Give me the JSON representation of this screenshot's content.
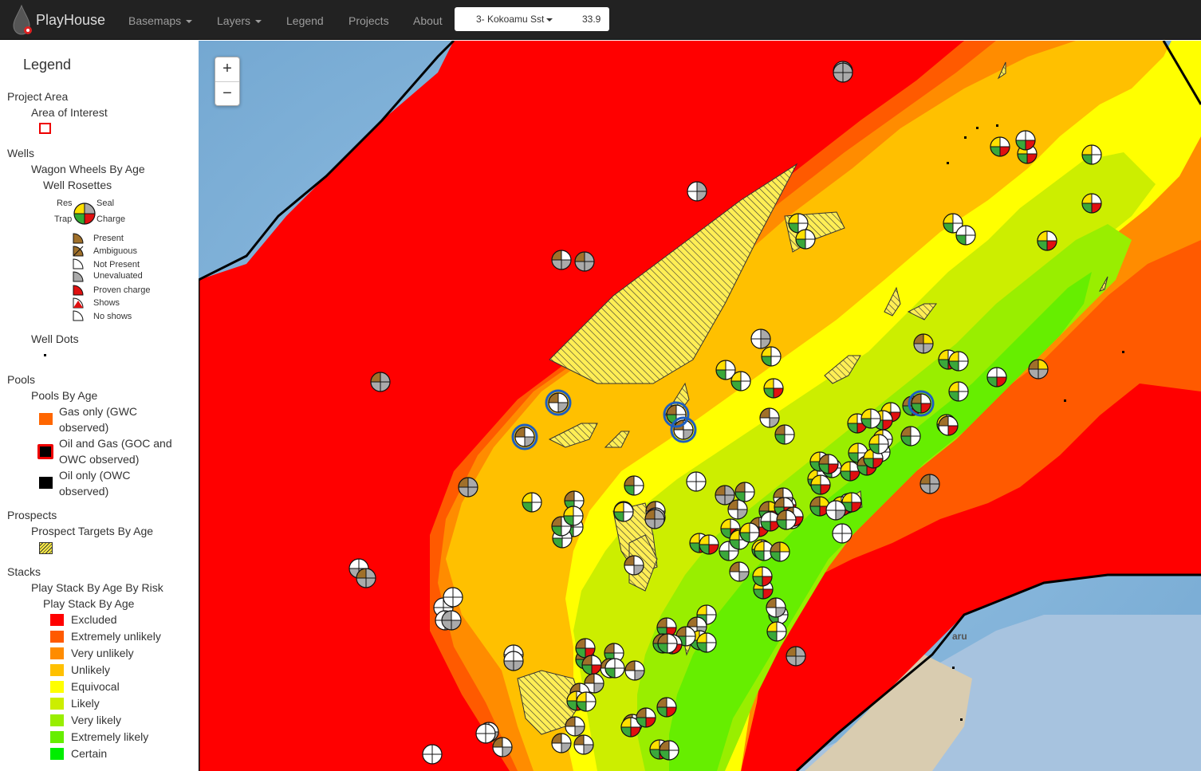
{
  "navbar": {
    "brand": "PlayHouse",
    "menu": {
      "basemaps": "Basemaps",
      "layers": "Layers",
      "legend": "Legend",
      "projects": "Projects",
      "about": "About"
    },
    "stack_select": {
      "selected": "3- Kokoamu Sst",
      "value": "33.9"
    }
  },
  "legend": {
    "title": "Legend",
    "project_area": {
      "heading": "Project Area",
      "item": "Area of Interest"
    },
    "wells": {
      "heading": "Wells",
      "wagon_wheels": "Wagon Wheels By Age",
      "well_rosettes": "Well Rosettes",
      "rosette_labels": {
        "res": "Res",
        "seal": "Seal",
        "trap": "Trap",
        "charge": "Charge"
      },
      "symbols": [
        "Present",
        "Ambiguous",
        "Not Present",
        "Unevaluated",
        "Proven charge",
        "Shows",
        "No shows"
      ],
      "well_dots": "Well Dots"
    },
    "pools": {
      "heading": "Pools",
      "by_age": "Pools By Age",
      "items": [
        {
          "line1": "Gas only (GWC",
          "line2": "observed)",
          "color": "#ff6600"
        },
        {
          "line1": "Oil and Gas (GOC and",
          "line2": "OWC observed)",
          "color": "#000000"
        },
        {
          "line1": "Oil only (OWC",
          "line2": "observed)",
          "color": "#000000"
        }
      ]
    },
    "prospects": {
      "heading": "Prospects",
      "targets": "Prospect Targets By Age"
    },
    "stacks": {
      "heading": "Stacks",
      "play_stack_risk": "Play Stack By Age By Risk",
      "play_stack": "Play Stack By Age",
      "items": [
        {
          "label": "Excluded",
          "color": "#ff0000"
        },
        {
          "label": "Extremely unlikely",
          "color": "#ff5a00"
        },
        {
          "label": "Very unlikely",
          "color": "#ff8c00"
        },
        {
          "label": "Unlikely",
          "color": "#ffc000"
        },
        {
          "label": "Equivocal",
          "color": "#ffff00"
        },
        {
          "label": "Likely",
          "color": "#ccee00"
        },
        {
          "label": "Very likely",
          "color": "#99ee00"
        },
        {
          "label": "Extremely likely",
          "color": "#66ee00"
        },
        {
          "label": "Certain",
          "color": "#00ee00"
        }
      ]
    }
  },
  "map": {
    "zoom_in": "+",
    "zoom_out": "−",
    "place_label": "aru"
  },
  "colors": {
    "navbar": "#222222",
    "present": "#a0702a",
    "unevaluated": "#aaaaaa",
    "proven_charge": "#e01010",
    "highlight_ring": "#1e5fc0"
  }
}
